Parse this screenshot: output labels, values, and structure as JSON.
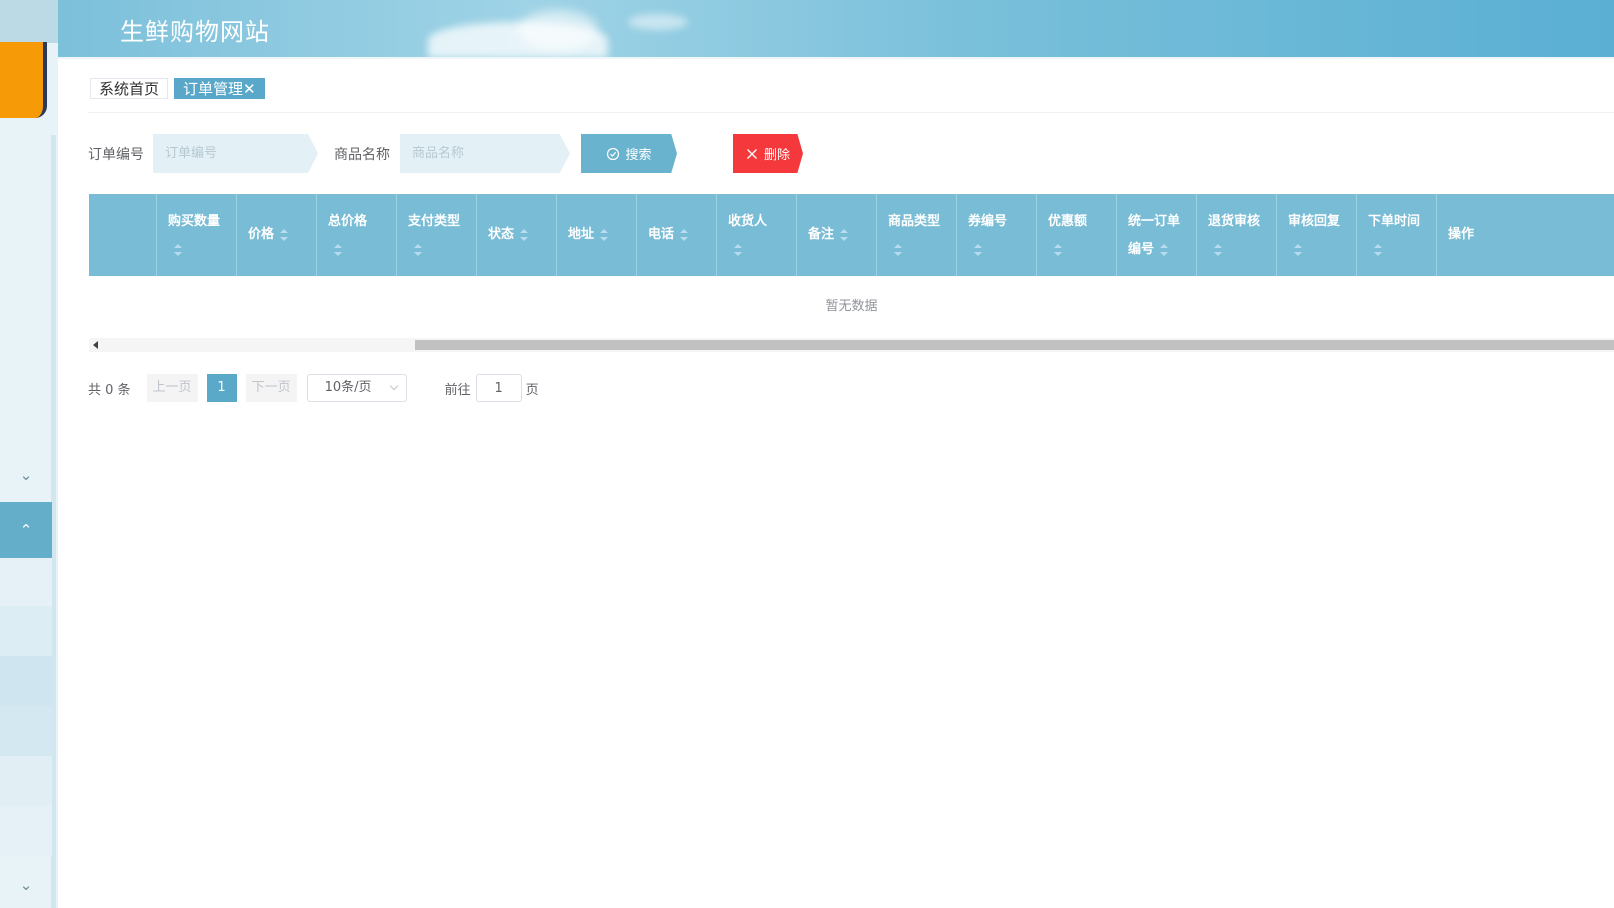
{
  "header": {
    "title": "生鲜购物网站"
  },
  "tabs": [
    {
      "label": "系统首页"
    },
    {
      "label": "订单管理",
      "close": "✕"
    }
  ],
  "search": {
    "order_no_label": "订单编号",
    "order_no_placeholder": "订单编号",
    "order_no_value": "",
    "product_name_label": "商品名称",
    "product_name_placeholder": "商品名称",
    "product_name_value": "",
    "search_button": "搜索",
    "delete_button": "删除"
  },
  "table": {
    "columns": [
      {
        "label": "购买数量",
        "sortable": true
      },
      {
        "label": "价格",
        "sortable": true
      },
      {
        "label": "总价格",
        "sortable": true
      },
      {
        "label": "支付类型",
        "sortable": true
      },
      {
        "label": "状态",
        "sortable": true
      },
      {
        "label": "地址",
        "sortable": true
      },
      {
        "label": "电话",
        "sortable": true
      },
      {
        "label": "收货人",
        "sortable": true
      },
      {
        "label": "备注",
        "sortable": true
      },
      {
        "label": "商品类型",
        "sortable": true
      },
      {
        "label": "券编号",
        "sortable": true
      },
      {
        "label": "优惠额",
        "sortable": true
      },
      {
        "label": "统一订单编号",
        "label_line1": "统一订单",
        "label_line2": "编号",
        "sortable": true
      },
      {
        "label": "退货审核",
        "sortable": true
      },
      {
        "label": "审核回复",
        "sortable": true
      },
      {
        "label": "下单时间",
        "sortable": true
      },
      {
        "label": "操作",
        "sortable": false
      }
    ],
    "rows": [],
    "empty_text": "暂无数据"
  },
  "pagination": {
    "total_text": "共 0 条",
    "prev": "上一页",
    "current_page": "1",
    "next": "下一页",
    "page_size": "10条/页",
    "goto_label": "前往",
    "goto_value": "1",
    "page_suffix": "页"
  },
  "colors": {
    "accent": "#5ba9c9",
    "table_header": "#79bcd6",
    "delete": "#f5383b",
    "avatar": "#f79a08"
  }
}
